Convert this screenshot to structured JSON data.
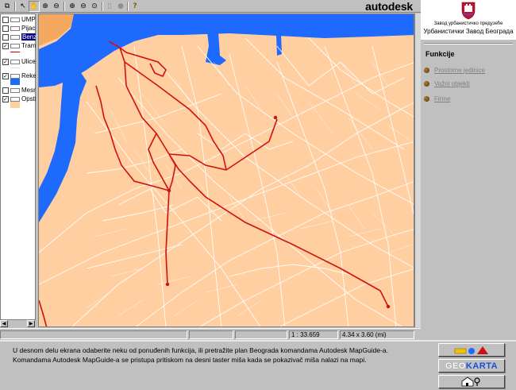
{
  "toolbar": {
    "brand": "autodesk",
    "tools": [
      {
        "name": "copy-tool-icon",
        "glyph": "⧉"
      },
      {
        "name": "pointer-tool-icon",
        "glyph": "↖"
      },
      {
        "name": "pan-tool-icon",
        "glyph": "✋"
      },
      {
        "name": "zoom-in-tool-icon",
        "glyph": "⊕"
      },
      {
        "name": "zoom-out-tool-icon",
        "glyph": "⊖"
      },
      {
        "name": "zoom-window-icon",
        "glyph": "⊕"
      },
      {
        "name": "zoom-previous-icon",
        "glyph": "⊖"
      },
      {
        "name": "zoom-extents-icon",
        "glyph": "⊙"
      },
      {
        "name": "print-tool-icon",
        "glyph": "▯"
      },
      {
        "name": "stop-tool-icon",
        "glyph": "●"
      },
      {
        "name": "help-tool-icon",
        "glyph": "?"
      }
    ]
  },
  "legend": {
    "layers": [
      {
        "label": "UMP",
        "checked": false,
        "selected": false
      },
      {
        "label": "Pijace",
        "checked": false,
        "selected": false
      },
      {
        "label": "Benzin",
        "checked": false,
        "selected": true
      },
      {
        "label": "Tramv",
        "checked": true,
        "selected": false
      },
      {
        "label": "Ulice",
        "checked": true,
        "selected": false
      },
      {
        "label": "Reke",
        "checked": true,
        "selected": false
      },
      {
        "label": "Mesne",
        "checked": false,
        "selected": false
      },
      {
        "label": "Opstin",
        "checked": true,
        "selected": false
      }
    ],
    "colors": {
      "tram": "#cc0000",
      "river": "#1e6aff",
      "municipality": "#ffcfa1"
    }
  },
  "map": {
    "colors": {
      "land": "#ffcfa1",
      "water": "#1e6aff",
      "streets": "#ffffff",
      "tram_lines": "#d01010",
      "park": "#f5a860"
    }
  },
  "status": {
    "scale": "1 : 33.659",
    "extent": "4.34 x 3.60 (mi)"
  },
  "panel": {
    "org_small": "Завод урбанистичко предузеће",
    "org_title": "Урбанистички Завод Београда",
    "functions_title": "Funkcije",
    "functions": [
      "Prostorne jedinice",
      "Važni objekti",
      "Firme"
    ]
  },
  "bottom": {
    "help_text": "U desnom delu ekrana odaberite neku od ponuđenih funkcija, ili pretražite plan Beograda komandama Autodesk MapGuide-a. Komandama Autodesk MapGuide-a se pristupa pritiskom na desni taster miša kada se pokazivač miša nalazi na mapi.",
    "geo_part1": "GEO",
    "geo_part2": "KARTA"
  }
}
